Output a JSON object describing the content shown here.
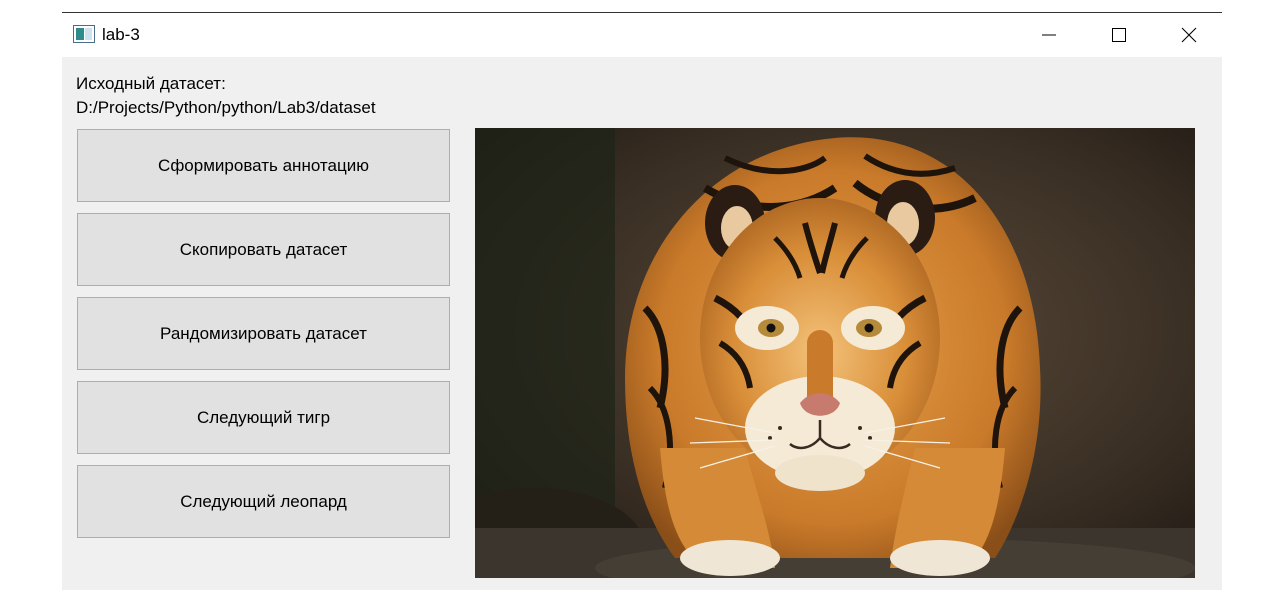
{
  "window": {
    "title": "lab-3",
    "icon": "app-window-icon",
    "controls": [
      "minimize-icon",
      "maximize-icon",
      "close-icon"
    ]
  },
  "dataset": {
    "label": "Исходный датасет:",
    "path": "D:/Projects/Python/python/Lab3/dataset"
  },
  "buttons": {
    "annotate": "Сформировать аннотацию",
    "copy": "Скопировать датасет",
    "randomize": "Рандомизировать датасет",
    "next_tiger": "Следующий тигр",
    "next_leopard": "Следующий леопард"
  },
  "image": {
    "subject": "tiger"
  },
  "colors": {
    "window_bg": "#f0f0f0",
    "button_bg": "#e1e1e1",
    "button_border": "#adadad"
  }
}
